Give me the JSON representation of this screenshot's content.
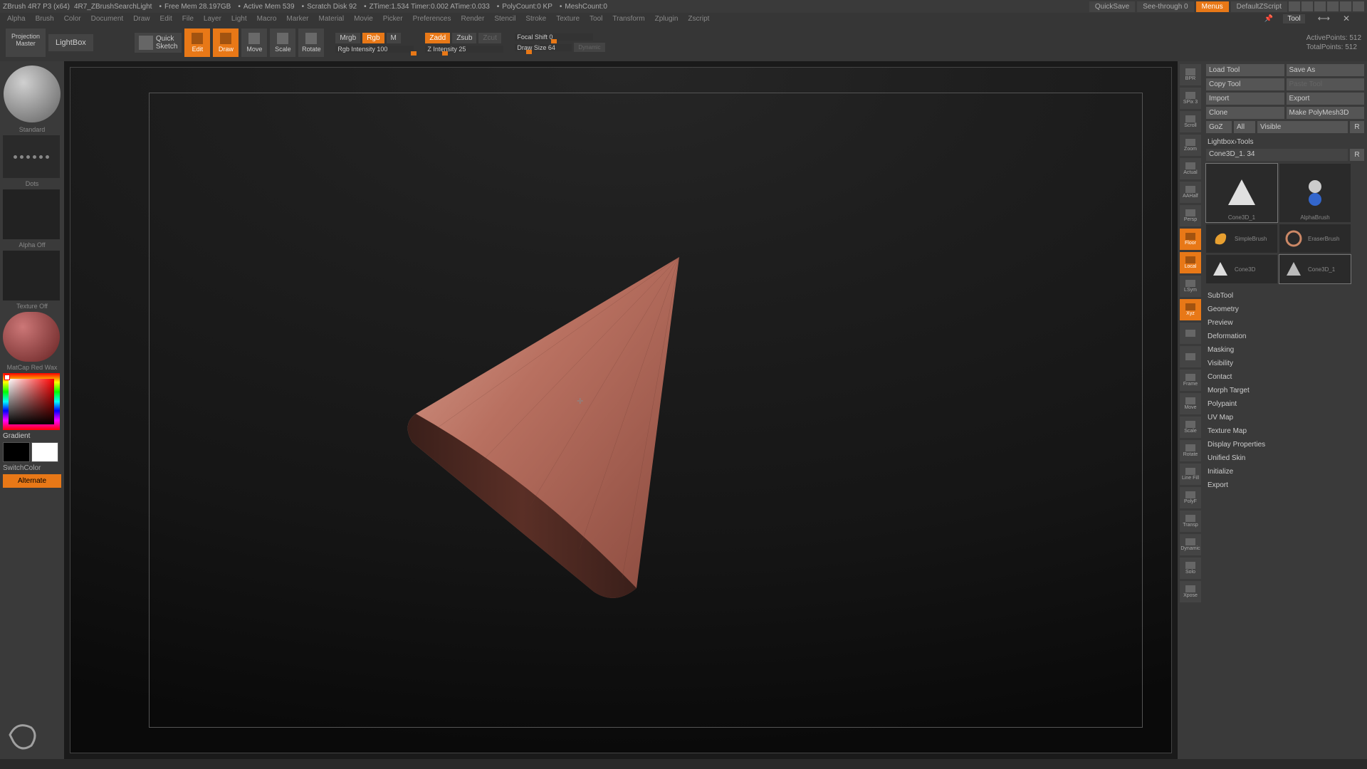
{
  "titlebar": {
    "app": "ZBrush 4R7 P3 (x64)",
    "doc": "4R7_ZBrushSearchLight",
    "freemem": "Free Mem 28.197GB",
    "activemem": "Active Mem 539",
    "scratch": "Scratch Disk 92",
    "ztime": "ZTime:1.534 Timer:0.002  ATime:0.033",
    "polycount": "PolyCount:0 KP",
    "meshcount": "MeshCount:0",
    "quicksave": "QuickSave",
    "seethrough": "See-through  0",
    "menus": "Menus",
    "script": "DefaultZScript"
  },
  "menus": [
    "Alpha",
    "Brush",
    "Color",
    "Document",
    "Draw",
    "Edit",
    "File",
    "Layer",
    "Light",
    "Macro",
    "Marker",
    "Material",
    "Movie",
    "Picker",
    "Preferences",
    "Render",
    "Stencil",
    "Stroke",
    "Texture",
    "Tool",
    "Transform",
    "Zplugin",
    "Zscript"
  ],
  "panel_title": "Tool",
  "toolbar": {
    "pm1": "Projection",
    "pm2": "Master",
    "lightbox": "LightBox",
    "qs1": "Quick",
    "qs2": "Sketch",
    "modes": {
      "edit": "Edit",
      "draw": "Draw",
      "move": "Move",
      "scale": "Scale",
      "rotate": "Rotate"
    },
    "mrgb": "Mrgb",
    "rgb": "Rgb",
    "m": "M",
    "rgb_intensity": "Rgb Intensity 100",
    "zadd": "Zadd",
    "zsub": "Zsub",
    "zcut": "Zcut",
    "z_intensity": "Z Intensity 25",
    "focal": "Focal Shift 0",
    "drawsize": "Draw Size 64",
    "dynamic": "Dynamic",
    "active_pts": "ActivePoints: 512",
    "total_pts": "TotalPoints: 512"
  },
  "left": {
    "brush": "Standard",
    "stroke": "Dots",
    "alpha": "Alpha  Off",
    "texture": "Texture Off",
    "material": "MatCap Red Wax",
    "gradient": "Gradient",
    "switchcolor": "SwitchColor",
    "alternate": "Alternate"
  },
  "right_tools": [
    "BPR",
    "SPix 3",
    "Scroll",
    "Zoom",
    "Actual",
    "AAHalf",
    "Persp",
    "Floor",
    "Local",
    "LSym",
    "Xyz",
    "",
    "",
    "Frame",
    "Move",
    "Scale",
    "Rotate",
    "Line Fill",
    "PolyF",
    "Transp",
    "Dynamic",
    "Solo",
    "Xpose"
  ],
  "right_active": [
    "Floor",
    "Local",
    "Xyz"
  ],
  "rp": {
    "load": "Load Tool",
    "save": "Save As",
    "copy": "Copy Tool",
    "paste": "Paste Tool",
    "import": "Import",
    "export": "Export",
    "clone": "Clone",
    "makepm": "Make PolyMesh3D",
    "goz": "GoZ",
    "all": "All",
    "visible": "Visible",
    "r": "R",
    "lbtools": "Lightbox›Tools",
    "cur_tool": "Cone3D_1. 34",
    "tools": [
      {
        "name": "Cone3D_1",
        "type": "cone-lit"
      },
      {
        "name": "AlphaBrush",
        "type": "alpha"
      },
      {
        "name": "SimpleBrush",
        "type": "simple"
      },
      {
        "name": "EraserBrush",
        "type": "eraser"
      },
      {
        "name": "Cone3D",
        "type": "cone-sm"
      },
      {
        "name": "Cone3D_1",
        "type": "cone-shade"
      }
    ],
    "sections": [
      "SubTool",
      "Geometry",
      "Preview",
      "Deformation",
      "Masking",
      "Visibility",
      "Contact",
      "Morph Target",
      "Polypaint",
      "UV Map",
      "Texture Map",
      "Display Properties",
      "Unified Skin",
      "Initialize",
      "Export"
    ]
  }
}
